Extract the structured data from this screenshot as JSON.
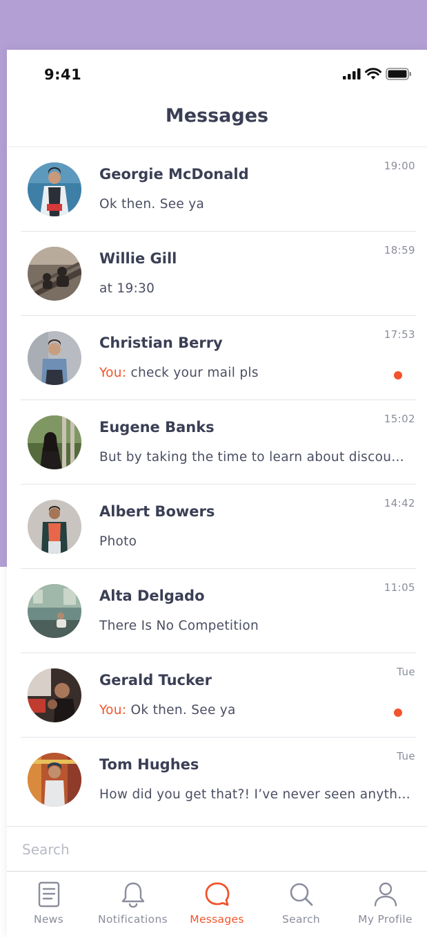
{
  "status_bar": {
    "time": "9:41"
  },
  "header": {
    "title": "Messages"
  },
  "colors": {
    "background": "#b39fd4",
    "accent": "#f1542b",
    "text": "#3b3f55"
  },
  "conversations": [
    {
      "name": "Georgie McDonald",
      "time": "19:00",
      "you_prefix": "",
      "preview": "Ok then. See ya",
      "unread": false
    },
    {
      "name": "Willie Gill",
      "time": "18:59",
      "you_prefix": "",
      "preview": "at 19:30",
      "unread": false
    },
    {
      "name": "Christian Berry",
      "time": "17:53",
      "you_prefix": "You:",
      "preview": "check your mail pls",
      "unread": true
    },
    {
      "name": "Eugene Banks",
      "time": "15:02",
      "you_prefix": "",
      "preview": "But by taking the time to learn about discou…",
      "unread": false
    },
    {
      "name": "Albert Bowers",
      "time": "14:42",
      "you_prefix": "",
      "preview": "Photo",
      "unread": false
    },
    {
      "name": "Alta Delgado",
      "time": "11:05",
      "you_prefix": "",
      "preview": "There Is No Competition",
      "unread": false
    },
    {
      "name": "Gerald Tucker",
      "time": "Tue",
      "you_prefix": "You:",
      "preview": "Ok then. See ya",
      "unread": true
    },
    {
      "name": "Tom Hughes",
      "time": "Tue",
      "you_prefix": "",
      "preview": "How did you get that?! I’ve never seen anythi…",
      "unread": false
    }
  ],
  "search": {
    "placeholder": "Search"
  },
  "tabs": [
    {
      "label": "News",
      "icon": "document-icon",
      "active": false
    },
    {
      "label": "Notifications",
      "icon": "bell-icon",
      "active": false
    },
    {
      "label": "Messages",
      "icon": "chat-bubble-icon",
      "active": true
    },
    {
      "label": "Search",
      "icon": "search-icon",
      "active": false
    },
    {
      "label": "My Profile",
      "icon": "user-icon",
      "active": false
    }
  ]
}
